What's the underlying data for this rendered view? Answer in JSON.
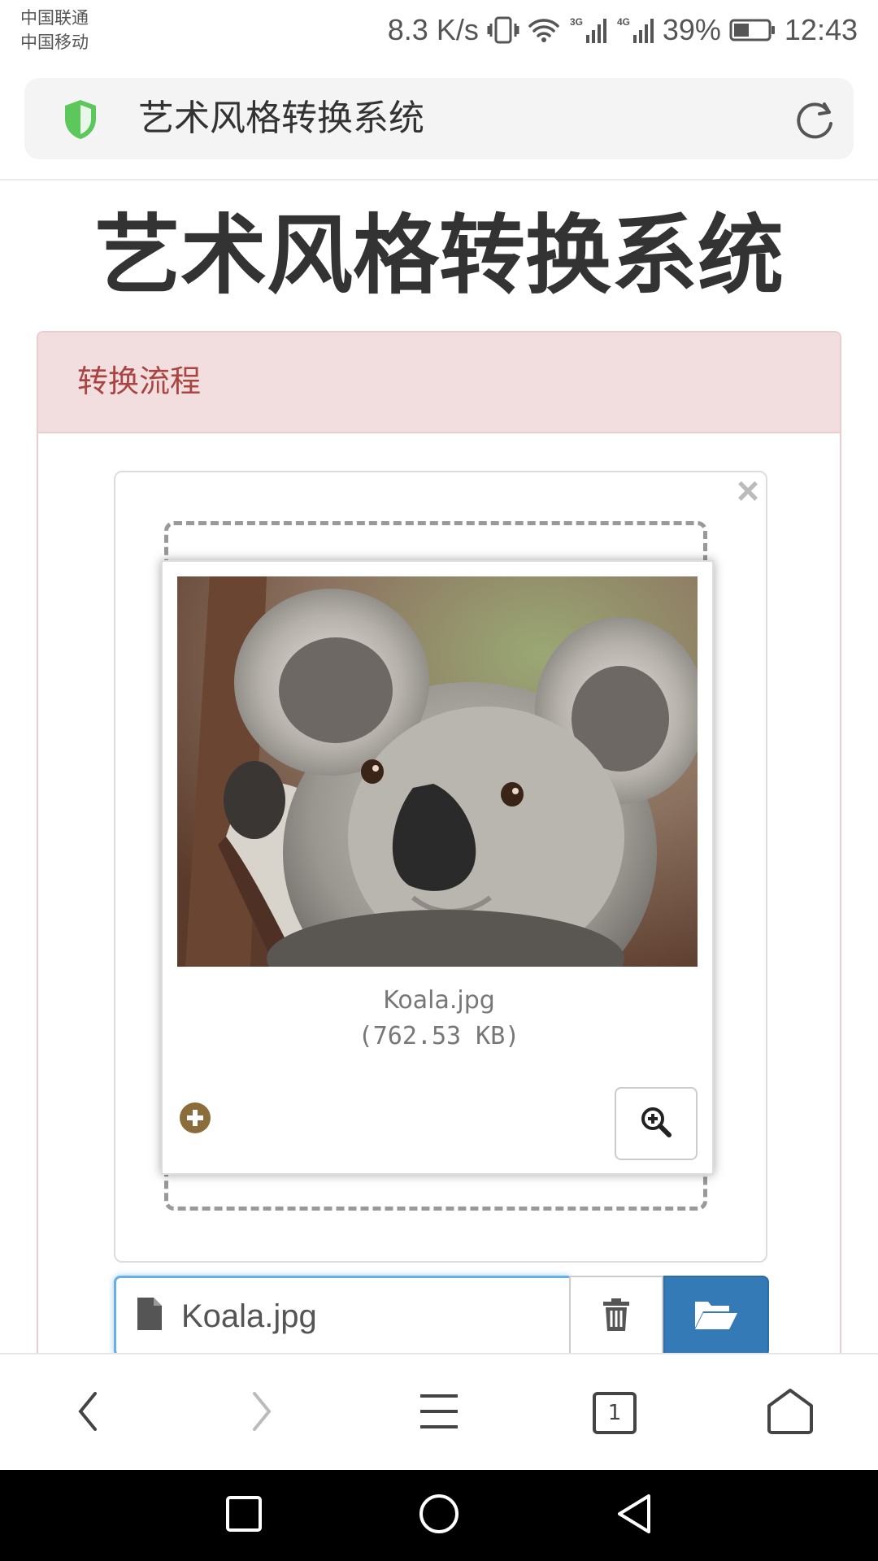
{
  "status_bar": {
    "carrier_1": "中国联通",
    "carrier_2": "中国移动",
    "net_speed": "8.3 K/s",
    "battery": "39%",
    "time": "12:43",
    "icons": [
      "vibrate-icon",
      "wifi-icon",
      "signal-3g-icon",
      "signal-4g-icon",
      "battery-icon"
    ]
  },
  "browser": {
    "address_title": "艺术风格转换系统",
    "secure_icon": "shield-icon",
    "reload_icon": "reload-icon",
    "tab_count": "1"
  },
  "page": {
    "title": "艺术风格转换系统",
    "panel_heading": "转换流程",
    "close_symbol": "×",
    "preview": {
      "file_name": "Koala.jpg",
      "file_size": "(762.53 KB)"
    },
    "file_input": {
      "value": "Koala.jpg"
    }
  },
  "colors": {
    "panel_heading_bg": "#f2dede",
    "panel_heading_text": "#a94442",
    "browse_button": "#337ab7",
    "shield": "#5cc85c",
    "plus_icon": "#8a6d3b"
  }
}
